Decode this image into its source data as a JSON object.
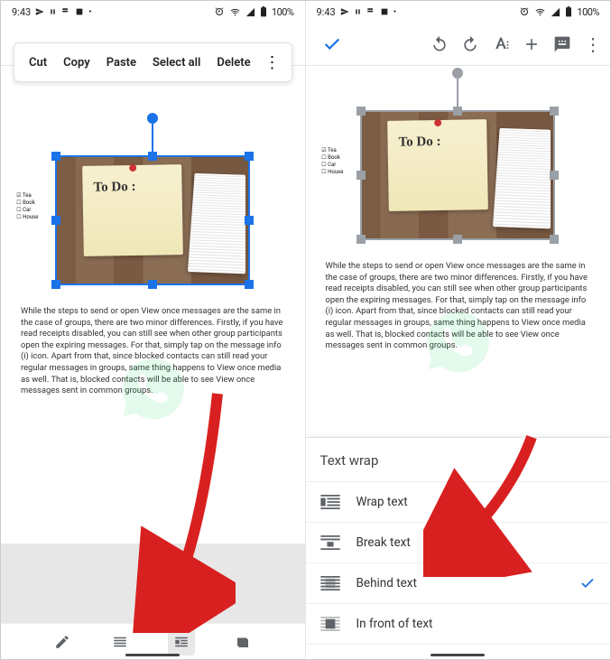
{
  "status": {
    "time": "9:43",
    "battery": "100%"
  },
  "context_menu": {
    "cut": "Cut",
    "copy": "Copy",
    "paste": "Paste",
    "select_all": "Select all",
    "delete": "Delete"
  },
  "sticky_text": "To Do :",
  "checklist": [
    "Tea",
    "Book",
    "Car",
    "House"
  ],
  "body_paragraph": "While the steps to send or open View once messages are the same in the case of groups, there are two minor differences. Firstly, if you have read receipts disabled, you can still see when other group participants open the expiring messages. For that, simply tap on the message info (i) icon. Apart from that, since blocked contacts can still read your regular messages in groups, same thing happens to View once media as well. That is, blocked contacts will be able to see View once messages sent in common groups.",
  "panel": {
    "title": "Text wrap",
    "items": {
      "wrap": "Wrap text",
      "break": "Break text",
      "behind": "Behind text",
      "front": "In front of text"
    },
    "selected": "behind"
  }
}
